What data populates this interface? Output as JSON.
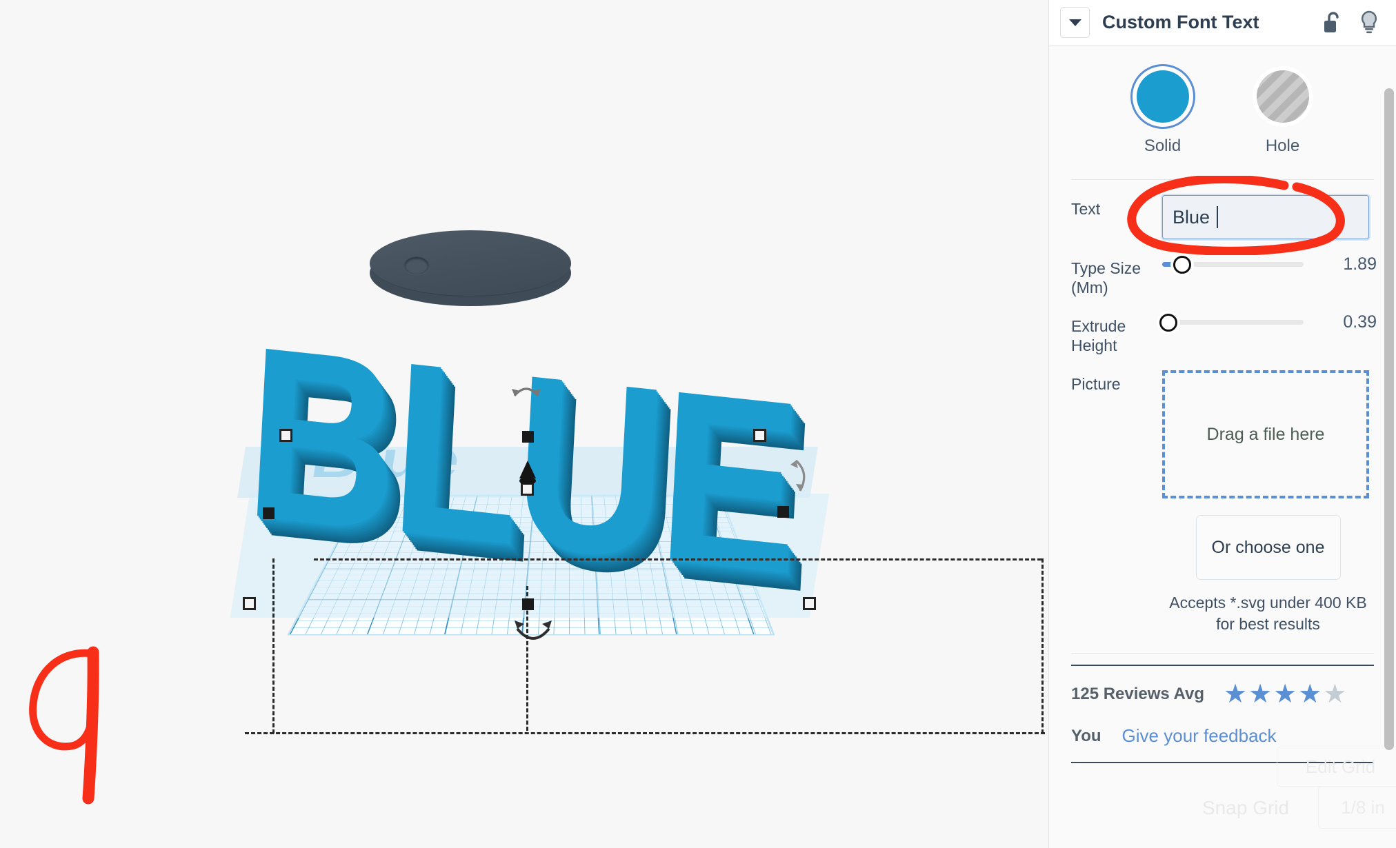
{
  "panel": {
    "title": "Custom Font Text",
    "collapse_icon": "chevron-down-icon",
    "lock_icon": "unlocked-padlock-icon",
    "light_icon": "lightbulb-icon",
    "shape": {
      "solid_label": "Solid",
      "hole_label": "Hole",
      "selected": "Solid",
      "solid_color": "#1b9dd0",
      "selection_ring_color": "#5b8fd4"
    },
    "fields": {
      "text": {
        "label": "Text",
        "value": "Blue ",
        "has_cursor": true
      },
      "type_size": {
        "label": "Type Size (Mm)",
        "label_line1": "Type Size",
        "label_line2": "(Mm)",
        "value": "1.89",
        "fill_percent": 13
      },
      "extrude_height": {
        "label": "Extrude Height",
        "label_line1": "Extrude",
        "label_line2": "Height",
        "value": "0.39",
        "fill_percent": 0
      },
      "picture": {
        "label": "Picture",
        "dropzone_text": "Drag a file here",
        "choose_button": "Or choose one",
        "hint": "Accepts *.svg under 400 KB for best results"
      }
    },
    "reviews": {
      "count_label": "125 Reviews Avg",
      "stars_filled": 4,
      "stars_total": 5,
      "star_glyph": "★",
      "star_color": "#5b8fd4",
      "star_empty_color": "#c4ccd4"
    },
    "feedback": {
      "you_label": "You",
      "link_label": "Give your feedback"
    }
  },
  "canvas": {
    "model_text": "BLUE",
    "ghost_text": "Blue",
    "model_color": "#1b9dd0",
    "disc_color": "#46525e",
    "workplane_grid_color": "#1d84bd",
    "handles": {
      "rotate_top_icon": "rotate-arrow-icon",
      "rotate_bottom_icon": "rotate-arrow-icon",
      "rotate_right_icon": "rotate-arrow-icon",
      "height_cone_icon": "extrude-cone-handle-icon"
    }
  },
  "background_ui": {
    "edit_grid": "Edit Grid",
    "snap_grid": "Snap Grid",
    "snap_value": "1/8 in"
  },
  "annotations": {
    "number_mark": "9",
    "ellipse_target": "text-input",
    "ink_color": "#f72f18"
  }
}
